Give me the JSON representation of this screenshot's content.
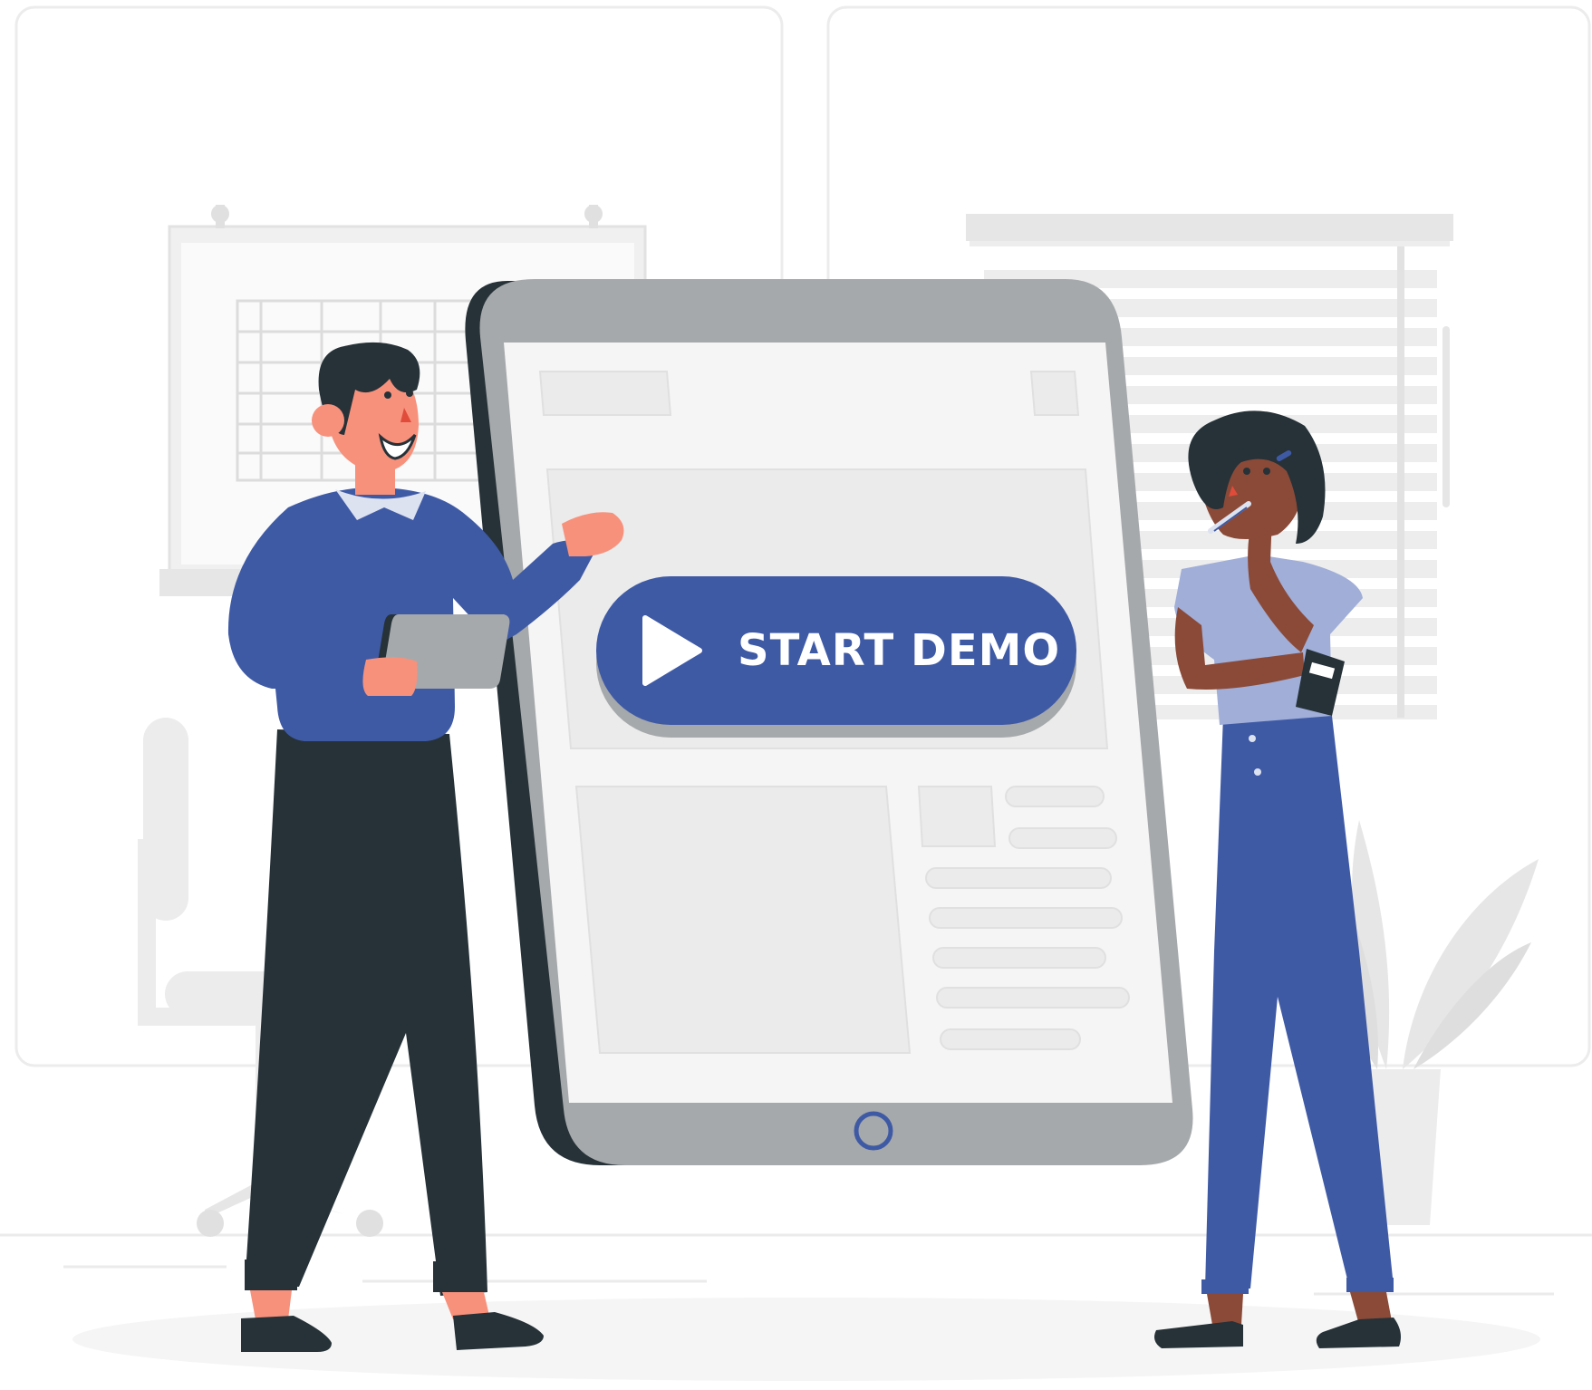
{
  "demo_button": {
    "label": "START DEMO",
    "icon": "play-icon"
  },
  "colors": {
    "accent": "#3f5aa5",
    "tablet_frame": "#a6a9ab",
    "tablet_dark": "#263238",
    "panel_light": "#ebebeb",
    "skin_man": "#f7917c",
    "skin_woman": "#8b4a38"
  }
}
